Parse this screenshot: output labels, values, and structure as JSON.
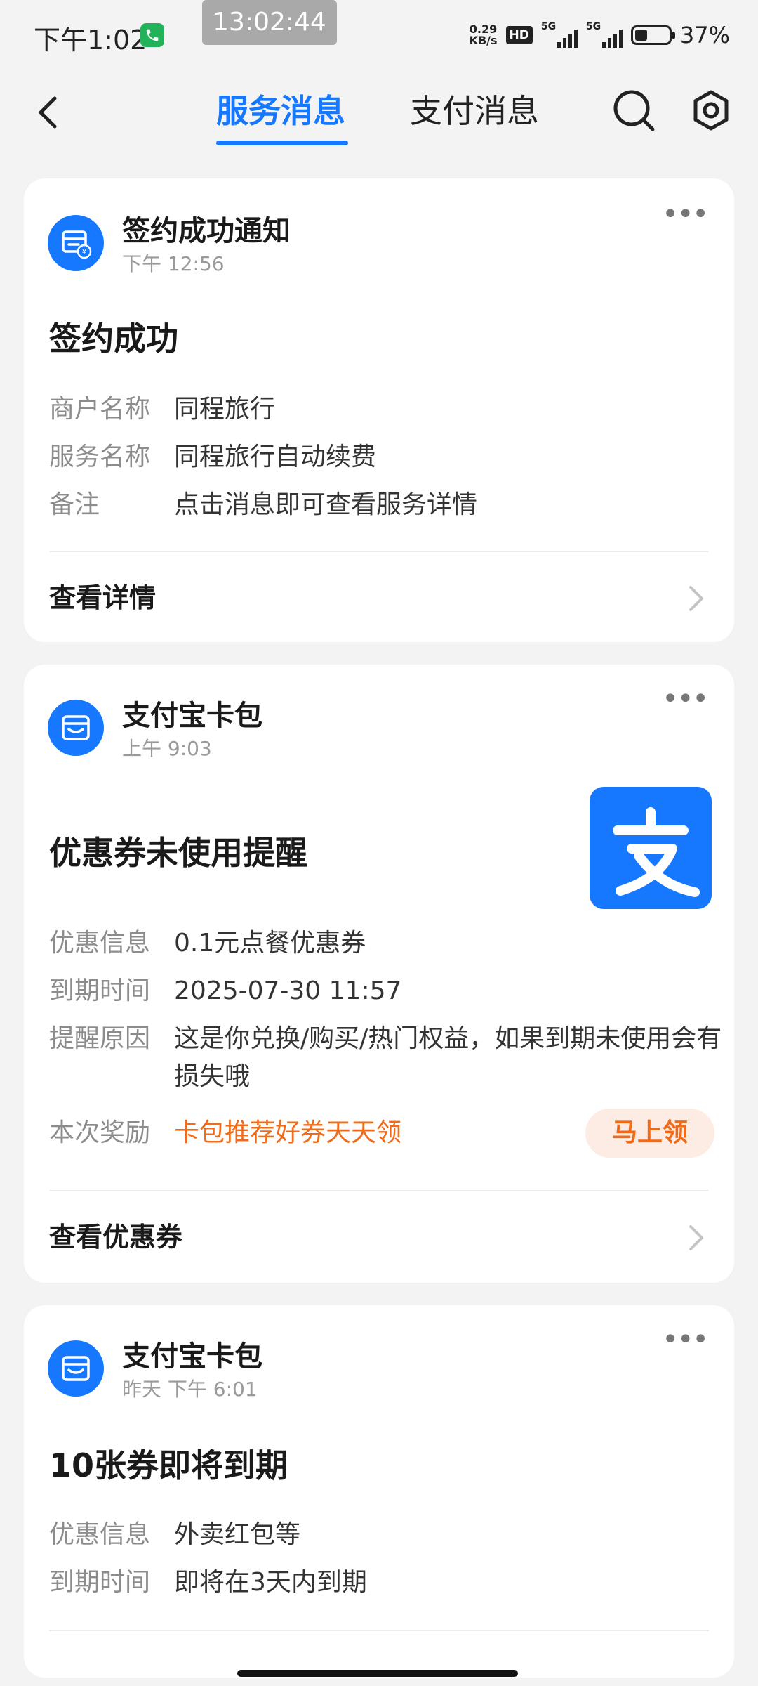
{
  "status_bar": {
    "time": "下午1:02",
    "clock_overlay": "13:02:44",
    "speed_value": "0.29",
    "speed_unit": "KB/s",
    "hd_badge": "HD",
    "net1": "5G",
    "net2": "5G",
    "battery_pct": "37%",
    "battery_level": 0.37
  },
  "header": {
    "tabs": [
      {
        "label": "服务消息",
        "active": true
      },
      {
        "label": "支付消息",
        "active": false
      }
    ]
  },
  "cards": [
    {
      "sender": "签约成功通知",
      "time": "下午 12:56",
      "title": "签约成功",
      "rows": [
        {
          "label": "商户名称",
          "value": "同程旅行"
        },
        {
          "label": "服务名称",
          "value": "同程旅行自动续费"
        },
        {
          "label": "备注",
          "value": "点击消息即可查看服务详情"
        }
      ],
      "link": "查看详情",
      "icon": "shop-yuan-icon"
    },
    {
      "sender": "支付宝卡包",
      "time": "上午 9:03",
      "title": "优惠券未使用提醒",
      "rows": [
        {
          "label": "优惠信息",
          "value": "0.1元点餐优惠券"
        },
        {
          "label": "到期时间",
          "value": "2025-07-30 11:57"
        },
        {
          "label": "提醒原因",
          "value": "这是你兑换/购买/热门权益，如果到期未使用会有损失哦"
        },
        {
          "label": "本次奖励",
          "value": "卡包推荐好券天天领"
        }
      ],
      "claim_button": "马上领",
      "link": "查看优惠券",
      "icon": "card-wallet-icon",
      "thumbnail": "alipay-logo"
    },
    {
      "sender": "支付宝卡包",
      "time": "昨天 下午 6:01",
      "title": "10张券即将到期",
      "rows": [
        {
          "label": "优惠信息",
          "value": "外卖红包等"
        },
        {
          "label": "到期时间",
          "value": "即将在3天内到期"
        }
      ],
      "icon": "card-wallet-icon"
    }
  ],
  "colors": {
    "accent": "#1677ff",
    "orange": "#f06a18",
    "background": "#f3f3f3"
  }
}
